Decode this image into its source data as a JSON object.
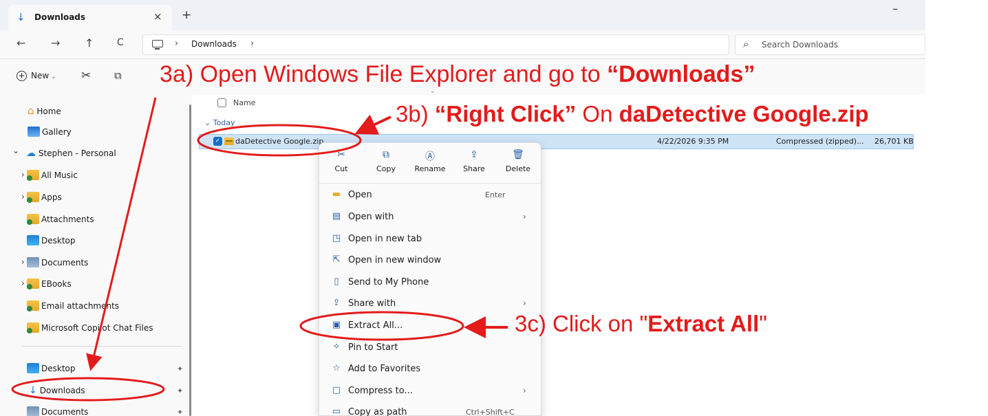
{
  "window": {
    "tab_title": "Downloads",
    "tab_icon": "↓",
    "tab_close": "×",
    "new_tab": "+",
    "minimize": "–"
  },
  "address": {
    "back": "←",
    "forward": "→",
    "up": "↑",
    "refresh": "C",
    "sep": "›",
    "breadcrumb": [
      "Downloads"
    ],
    "search_placeholder": "Search Downloads"
  },
  "toolbar": {
    "new_label": "New",
    "plus": "+",
    "caret": "⌄",
    "cut_icon": "✂",
    "copy_icon": "⧉"
  },
  "sidebar": {
    "home": "Home",
    "gallery": "Gallery",
    "account": "Stephen - Personal",
    "folders": [
      "All Music",
      "Apps",
      "Attachments",
      "Desktop",
      "Documents",
      "EBooks",
      "Email attachments",
      "Microsoft Copilot Chat Files"
    ],
    "pinned": [
      "Desktop",
      "Downloads",
      "Documents"
    ],
    "chevron": "›",
    "expand": "⌄",
    "pin_icon": "📌"
  },
  "list": {
    "header_name": "Name",
    "group": "Today",
    "file": {
      "name": "daDetective Google.zip",
      "date": "4/22/2026 9:35 PM",
      "type": "Compressed (zipped)...",
      "size": "26,701 KB"
    }
  },
  "context_menu": {
    "quick_actions": [
      {
        "label": "Cut",
        "icon": "✂"
      },
      {
        "label": "Copy",
        "icon": "⧉"
      },
      {
        "label": "Rename",
        "icon": "Ⓐ"
      },
      {
        "label": "Share",
        "icon": "⇪"
      },
      {
        "label": "Delete",
        "icon": "🗑"
      }
    ],
    "items": [
      {
        "label": "Open",
        "shortcut": "Enter",
        "icon": "▬"
      },
      {
        "label": "Open with",
        "chevron": "›",
        "icon": "▤"
      },
      {
        "label": "Open in new tab",
        "icon": "◳"
      },
      {
        "label": "Open in new window",
        "icon": "⇱"
      },
      {
        "label": "Send to My Phone",
        "icon": "▯"
      },
      {
        "label": "Share with",
        "chevron": "›",
        "icon": "⇪"
      },
      {
        "label": "Extract All...",
        "icon": "▣"
      },
      {
        "label": "Pin to Start",
        "icon": "✧"
      },
      {
        "label": "Add to Favorites",
        "icon": "☆"
      },
      {
        "label": "Compress to...",
        "chevron": "›",
        "icon": "▢"
      },
      {
        "label": "Copy as path",
        "shortcut": "Ctrl+Shift+C",
        "icon": "▭"
      }
    ]
  },
  "annotations": {
    "step_a_prefix": "3a) Open Windows File Explorer and go to ",
    "step_a_bold": "“Downloads”",
    "step_b_prefix": "3b)  ",
    "step_b_bold1": "“Right Click”",
    "step_b_mid": " On ",
    "step_b_bold2": "daDetective Google.zip",
    "step_c_prefix": "3c) Click on \"",
    "step_c_bold": "Extract All",
    "step_c_suffix": "\""
  },
  "colors": {
    "annotation": "#e31b1b",
    "selection": "#cfe3f7",
    "accent": "#1a6cc4"
  }
}
